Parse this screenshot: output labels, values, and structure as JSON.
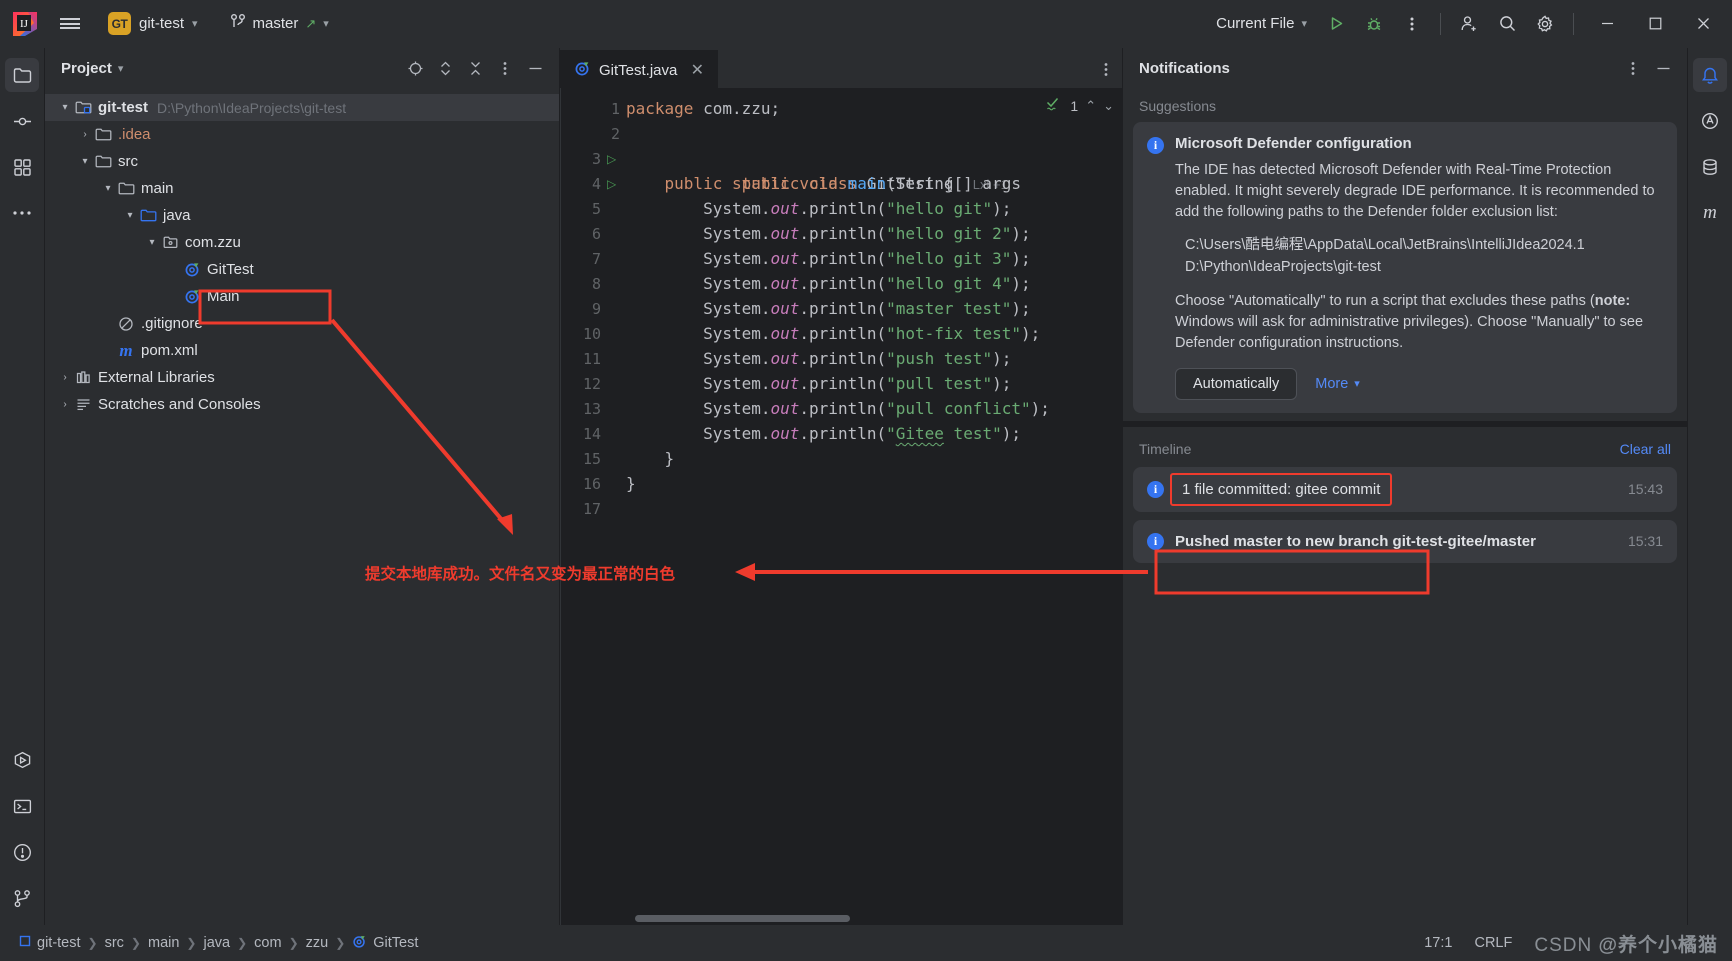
{
  "titlebar": {
    "menu_icon": "hamburger-icon",
    "project_badge": "GT",
    "project_name": "git-test",
    "branch_icon": "git-branch-icon",
    "branch_name": "master",
    "run_config": "Current File",
    "run_icon": "run-icon",
    "debug_icon": "debug-icon",
    "more_icon": "more-vertical-icon",
    "account_icon": "add-user-icon",
    "search_icon": "search-icon",
    "settings_icon": "gear-icon",
    "minimize": "minimize-icon",
    "maximize": "maximize-icon",
    "close": "close-icon"
  },
  "left_stripe": {
    "items": [
      {
        "name": "project-tool-icon",
        "active": true
      },
      {
        "name": "commit-tool-icon",
        "active": false
      },
      {
        "name": "structure-tool-icon",
        "active": false
      },
      {
        "name": "more-tool-icon",
        "active": false
      }
    ],
    "bottom_items": [
      {
        "name": "run-tool-icon"
      },
      {
        "name": "terminal-tool-icon"
      },
      {
        "name": "problems-tool-icon"
      },
      {
        "name": "version-control-tool-icon"
      }
    ]
  },
  "right_stripe": {
    "items": [
      {
        "name": "notifications-tool-icon",
        "active": true
      },
      {
        "name": "ai-assistant-tool-icon",
        "active": false
      },
      {
        "name": "database-tool-icon",
        "active": false
      },
      {
        "name": "maven-tool-icon",
        "active": false
      }
    ]
  },
  "project_panel": {
    "title": "Project",
    "title_chevron": "chevron-down-icon",
    "actions": [
      "select-opened-file-icon",
      "expand-collapse-icon",
      "collapse-all-icon",
      "options-icon",
      "hide-icon"
    ],
    "tree": [
      {
        "depth": 0,
        "arrow": "down",
        "icon": "module-folder-icon",
        "label": "git-test",
        "bold": true,
        "path": "D:\\Python\\IdeaProjects\\git-test",
        "selected": true
      },
      {
        "depth": 1,
        "arrow": "right",
        "icon": "folder-icon",
        "label": ".idea",
        "bold": false,
        "orange": true
      },
      {
        "depth": 1,
        "arrow": "down",
        "icon": "folder-icon",
        "label": "src",
        "bold": false
      },
      {
        "depth": 2,
        "arrow": "down",
        "icon": "folder-icon",
        "label": "main",
        "bold": false
      },
      {
        "depth": 3,
        "arrow": "down",
        "icon": "source-folder-icon",
        "label": "java",
        "bold": false
      },
      {
        "depth": 4,
        "arrow": "down",
        "icon": "package-icon",
        "label": "com.zzu",
        "bold": false
      },
      {
        "depth": 5,
        "arrow": "none",
        "icon": "java-class-icon",
        "label": "GitTest",
        "bold": false,
        "highlighted": true
      },
      {
        "depth": 5,
        "arrow": "none",
        "icon": "java-class-icon",
        "label": "Main",
        "bold": false
      },
      {
        "depth": 2,
        "arrow": "none",
        "icon": "gitignore-icon",
        "label": ".gitignore",
        "bold": false
      },
      {
        "depth": 2,
        "arrow": "none",
        "icon": "maven-icon",
        "label": "pom.xml",
        "bold": false
      },
      {
        "depth": 0,
        "arrow": "right",
        "icon": "libraries-icon",
        "label": "External Libraries",
        "bold": false
      },
      {
        "depth": 0,
        "arrow": "right",
        "icon": "scratches-icon",
        "label": "Scratches and Consoles",
        "bold": false
      }
    ]
  },
  "editor": {
    "tab": {
      "label": "GitTest.java",
      "icon": "java-class-icon",
      "close": "close-icon"
    },
    "tab_more_icon": "more-vertical-icon",
    "inspection": {
      "icon": "inspection-check-icon",
      "count": "1",
      "up": "chevron-up-icon",
      "down": "chevron-down-icon"
    },
    "inlay_hint": "Lxl +1",
    "lines": [
      {
        "n": "1",
        "run": false
      },
      {
        "n": "2",
        "run": false
      },
      {
        "n": "3",
        "run": true
      },
      {
        "n": "4",
        "run": true
      },
      {
        "n": "5",
        "run": false
      },
      {
        "n": "6",
        "run": false
      },
      {
        "n": "7",
        "run": false
      },
      {
        "n": "8",
        "run": false
      },
      {
        "n": "9",
        "run": false
      },
      {
        "n": "10",
        "run": false
      },
      {
        "n": "11",
        "run": false
      },
      {
        "n": "12",
        "run": false
      },
      {
        "n": "13",
        "run": false
      },
      {
        "n": "14",
        "run": false
      },
      {
        "n": "15",
        "run": false
      },
      {
        "n": "16",
        "run": false
      },
      {
        "n": "17",
        "run": false
      }
    ],
    "code_strings": [
      "hello git",
      "hello git 2",
      "hello git 3",
      "hello git 4",
      "master test",
      "hot-fix test",
      "push test",
      "pull test",
      "pull conflict",
      "Gitee test"
    ],
    "package_line": "package com.zzu;",
    "class_line": "public class GitTest {",
    "main_line": "public static void main(String[] args"
  },
  "notifications": {
    "title": "Notifications",
    "actions": [
      "options-icon",
      "hide-icon"
    ],
    "section_suggestions": "Suggestions",
    "card": {
      "icon": "info-icon",
      "title": "Microsoft Defender configuration",
      "body1": "The IDE has detected Microsoft Defender with Real-Time Protection enabled. It might severely degrade IDE performance. It is recommended to add the following paths to the Defender folder exclusion list:",
      "paths": [
        "C:\\Users\\酷电编程\\AppData\\Local\\JetBrains\\IntelliJIdea2024.1",
        "D:\\Python\\IdeaProjects\\git-test"
      ],
      "body2_a": "Choose \"Automatically\" to run a script that excludes these paths (",
      "body2_note": "note:",
      "body2_b": " Windows will ask for administrative privileges). Choose \"Manually\" to see Defender configuration instructions.",
      "primary_button": "Automatically",
      "more_link": "More",
      "more_chevron": "chevron-down-icon"
    },
    "section_timeline": "Timeline",
    "clear_all": "Clear all",
    "timeline": [
      {
        "icon": "info-icon",
        "text": "1 file committed: gitee commit",
        "time": "15:43",
        "bold": false,
        "highlighted": true
      },
      {
        "icon": "info-icon",
        "text": "Pushed master to new branch git-test-gitee/master",
        "time": "15:31",
        "bold": true,
        "highlighted": false
      }
    ]
  },
  "annotation": {
    "text": "提交本地库成功。文件名又变为最正常的白色",
    "color": "#ef3b2d"
  },
  "statusbar": {
    "breadcrumbs": [
      {
        "label": "git-test",
        "icon": "module-icon"
      },
      {
        "label": "src",
        "icon": ""
      },
      {
        "label": "main",
        "icon": ""
      },
      {
        "label": "java",
        "icon": ""
      },
      {
        "label": "com",
        "icon": ""
      },
      {
        "label": "zzu",
        "icon": ""
      },
      {
        "label": "GitTest",
        "icon": "java-class-icon"
      }
    ],
    "caret": "17:1",
    "line_sep": "CRLF",
    "watermark_a": "CSDN ",
    "watermark_b": "@养个小橘猫"
  },
  "colors": {
    "accent_blue": "#3574f0",
    "link_blue": "#548af7",
    "annotation_red": "#ef3b2d",
    "bg_dark": "#1e1f22",
    "bg_panel": "#2b2d30",
    "bg_card": "#393b40",
    "string_green": "#6aab73",
    "keyword_orange": "#cf8e6d"
  }
}
